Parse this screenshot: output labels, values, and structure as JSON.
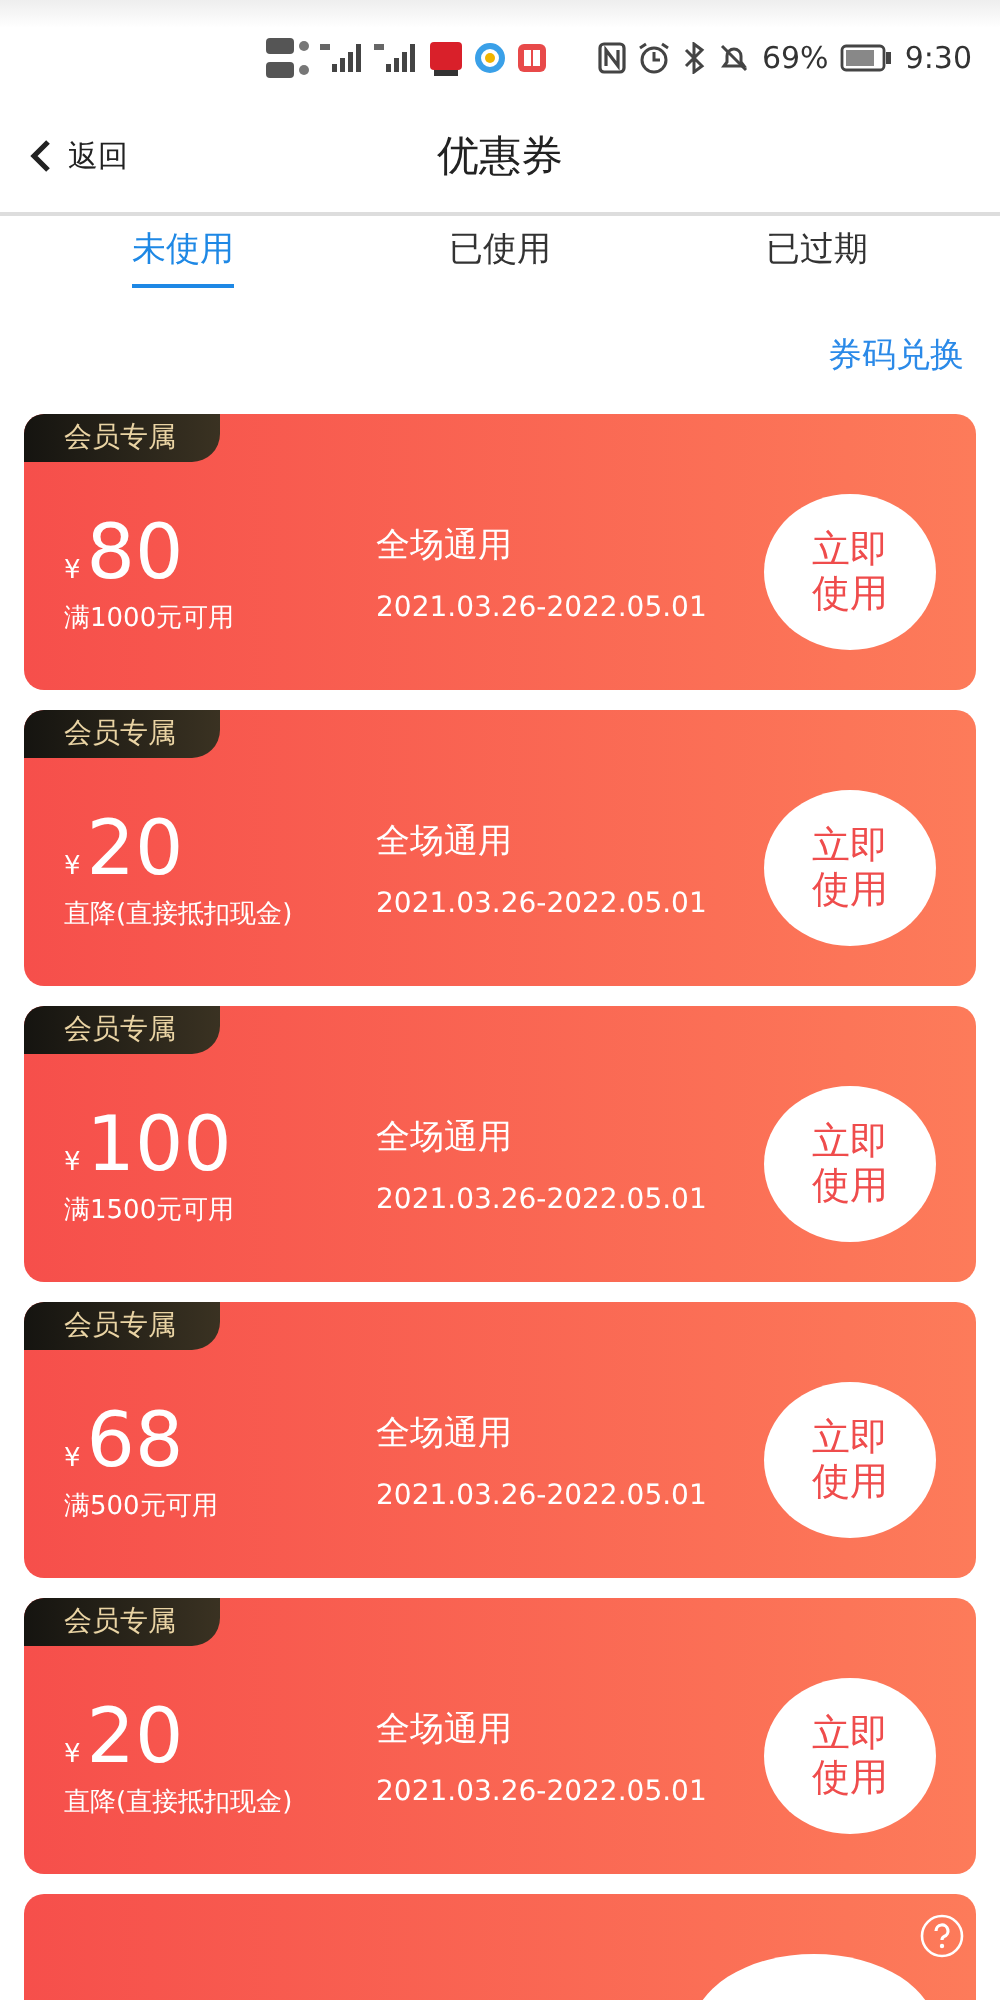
{
  "status_bar": {
    "battery": "69%",
    "time": "9:30"
  },
  "header": {
    "back": "返回",
    "title": "优惠券"
  },
  "tabs": [
    {
      "label": "未使用",
      "selected": true
    },
    {
      "label": "已使用",
      "selected": false
    },
    {
      "label": "已过期",
      "selected": false
    }
  ],
  "redeem_link": "券码兑换",
  "coupons": [
    {
      "tag": "会员专属",
      "currency": "¥",
      "amount": "80",
      "condition": "满1000元可用",
      "scope": "全场通用",
      "validity": "2021.03.26-2022.05.01",
      "action": "立即使用"
    },
    {
      "tag": "会员专属",
      "currency": "¥",
      "amount": "20",
      "condition": "直降(直接抵扣现金)",
      "scope": "全场通用",
      "validity": "2021.03.26-2022.05.01",
      "action": "立即使用"
    },
    {
      "tag": "会员专属",
      "currency": "¥",
      "amount": "100",
      "condition": "满1500元可用",
      "scope": "全场通用",
      "validity": "2021.03.26-2022.05.01",
      "action": "立即使用"
    },
    {
      "tag": "会员专属",
      "currency": "¥",
      "amount": "68",
      "condition": "满500元可用",
      "scope": "全场通用",
      "validity": "2021.03.26-2022.05.01",
      "action": "立即使用"
    },
    {
      "tag": "会员专属",
      "currency": "¥",
      "amount": "20",
      "condition": "直降(直接抵扣现金)",
      "scope": "全场通用",
      "validity": "2021.03.26-2022.05.01",
      "action": "立即使用"
    },
    {
      "kind": "partial"
    }
  ]
}
